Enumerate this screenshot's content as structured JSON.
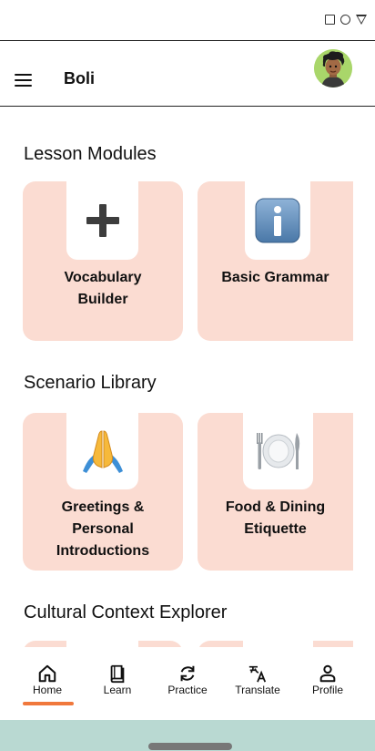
{
  "status_bar": {
    "icons": [
      "square-icon",
      "circle-icon",
      "triangle-icon"
    ]
  },
  "app_bar": {
    "title": "Boli",
    "menu_icon": "hamburger-menu-icon",
    "avatar": "user-avatar"
  },
  "sections": [
    {
      "title": "Lesson Modules",
      "cards": [
        {
          "label_lines": [
            "Vocabulary",
            "Builder"
          ],
          "icon": "plus-icon"
        },
        {
          "label_lines": [
            "Basic Grammar"
          ],
          "icon": "info-icon"
        }
      ]
    },
    {
      "title": "Scenario Library",
      "cards": [
        {
          "label_lines": [
            "Greetings &",
            "Personal",
            "Introductions"
          ],
          "icon": "folded-hands-icon"
        },
        {
          "label_lines": [
            "Food & Dining",
            "Etiquette"
          ],
          "icon": "plate-cutlery-icon"
        }
      ]
    },
    {
      "title": "Cultural Context Explorer",
      "cards": []
    }
  ],
  "bottom_nav": {
    "active": "Home",
    "items": [
      {
        "label": "Home",
        "icon": "home-icon"
      },
      {
        "label": "Learn",
        "icon": "book-icon"
      },
      {
        "label": "Practice",
        "icon": "refresh-icon"
      },
      {
        "label": "Translate",
        "icon": "translate-icon"
      },
      {
        "label": "Profile",
        "icon": "person-icon"
      }
    ]
  },
  "colors": {
    "card_bg": "#fbdcd2",
    "active_indicator": "#f0783c",
    "gesture_bar": "#b9d9d2",
    "avatar_bg": "#a9d66a"
  }
}
